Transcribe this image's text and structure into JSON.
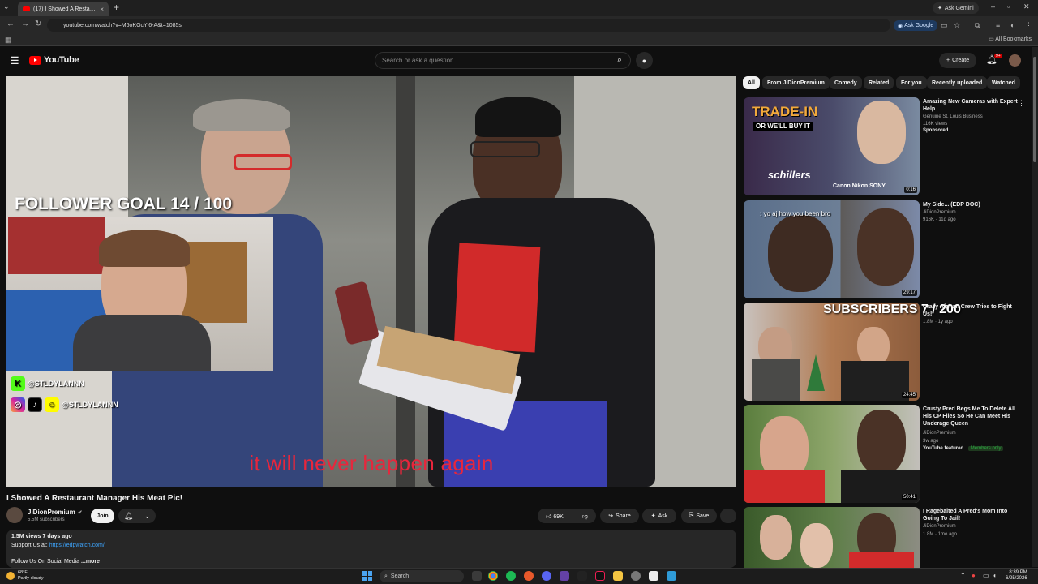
{
  "browser": {
    "tab_title": "(17) I Showed A Restaurant Ma",
    "tab_close": "×",
    "new_tab": "+",
    "ask_gemini": "Ask Gemini",
    "url": "youtube.com/watch?v=M6oKGcYl6-A&t=1085s",
    "ask_google": "Ask Google",
    "all_bookmarks": "All Bookmarks"
  },
  "yt_header": {
    "logo": "YouTube",
    "search_placeholder": "Search or ask a question",
    "create_label": "Create",
    "notif_count": "9+"
  },
  "player": {
    "subtitle": "it will never happen again",
    "follower_goal": "FOLLOWER GOAL 14 / 100",
    "subscribers_goal": "SUBSCRIBERS 7 / 200",
    "kick_handle": "@STLDYLANNN",
    "social_handle": "@STLDYLANNN"
  },
  "video": {
    "title": "I Showed A Restaurant Manager His Meat Pic!",
    "channel": "JiDionPremium",
    "subs": "5.5M subscribers",
    "join": "Join",
    "likes": "69K",
    "share": "Share",
    "ask": "Ask",
    "save": "Save",
    "more": "...",
    "desc_meta": "1.5M views  7 days ago",
    "desc_support_label": "Support Us at: ",
    "desc_support_link": "https://edpwatch.com/",
    "desc_social": "Follow Us On Social Media",
    "desc_more": "...more"
  },
  "chips": [
    "All",
    "From JiDionPremium",
    "Comedy",
    "Related",
    "For you",
    "Recently uploaded",
    "Watched"
  ],
  "recommendations": [
    {
      "title": "Amazing New Cameras with Expert Help",
      "channel": "Genuine St. Louis Business",
      "views": "116K views",
      "badge": "Sponsored",
      "duration": "0:16",
      "thumb_top_text": "TRADE-IN",
      "thumb_sub_text": "OR WE'LL BUY IT",
      "thumb_brand": "schillers",
      "thumb_brands": "Canon  Nikon  SONY"
    },
    {
      "title": "My Side... (EDP  DOC)",
      "channel": "JiDionPremium",
      "views": "916K · 11d ago",
      "duration": "29:17",
      "chat_line": ": yo aj how you been bro"
    },
    {
      "title": "Crazy Afghan Crew Tries to Fight Us!",
      "views": "1.8M · 1y ago",
      "duration": "24:45"
    },
    {
      "title": "Crusty Pred Begs Me To Delete All His CP Files So He Can Meet His Underage Queen",
      "channel": "JiDionPremium",
      "views": "3w ago",
      "badge": "YouTube featured",
      "members": "Members only",
      "duration": "50:41"
    },
    {
      "title": "I Ragebaited A Pred's Mom Into Going To Jail!",
      "channel": "JiDionPremium",
      "views": "1.8M · 1mo ago"
    }
  ],
  "taskbar": {
    "temp": "68°F",
    "weather": "Partly cloudy",
    "search": "Search",
    "time": "8:39 PM",
    "date": "6/25/2026"
  }
}
